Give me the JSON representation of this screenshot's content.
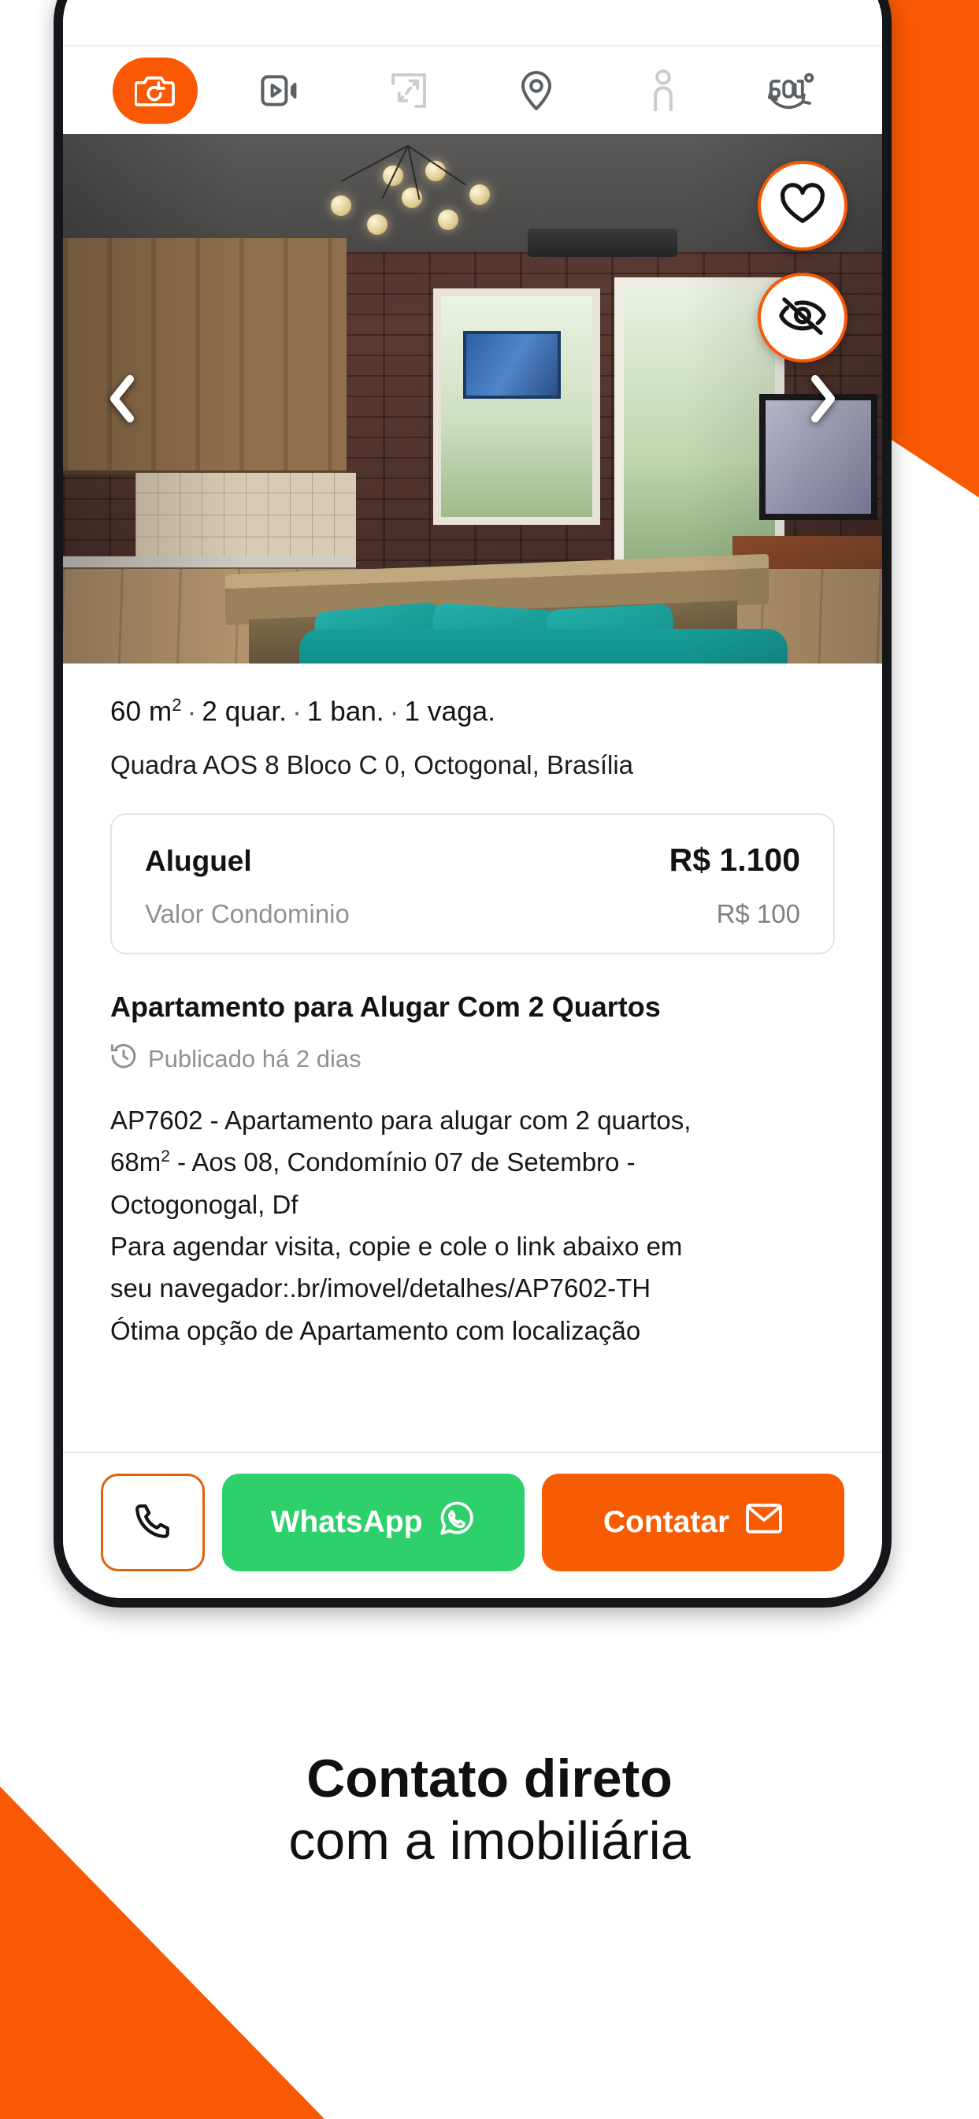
{
  "theme": {
    "accent_orange": "#f95804",
    "whatsapp_green": "#2ed06b",
    "contact_orange": "#f75c02",
    "text_dark": "#111315",
    "text_muted": "#8d9295"
  },
  "media_tabs": [
    {
      "name": "photos",
      "icon": "camera-icon",
      "active": true
    },
    {
      "name": "video",
      "icon": "video-icon",
      "active": false
    },
    {
      "name": "floorplan",
      "icon": "floorplan-icon",
      "active": false
    },
    {
      "name": "map",
      "icon": "map-pin-icon",
      "active": false
    },
    {
      "name": "virtual-tour",
      "icon": "person-icon",
      "active": false
    },
    {
      "name": "panorama",
      "icon": "360-icon",
      "active": false
    }
  ],
  "gallery": {
    "prev_label": "‹",
    "next_label": "›",
    "favorite_icon": "heart-icon",
    "hide_icon": "eye-off-icon"
  },
  "listing": {
    "area": "60 m",
    "area_sup": "2",
    "bedrooms": "2 quar.",
    "bathrooms": "1 ban.",
    "parking": "1 vaga.",
    "separator": "·",
    "address": "Quadra AOS 8 Bloco C 0, Octogonal, Brasília",
    "price": {
      "rent_label": "Aluguel",
      "rent_value": "R$ 1.100",
      "condo_label": "Valor Condominio",
      "condo_value": "R$ 100"
    },
    "title": "Apartamento para Alugar Com 2 Quartos",
    "published": "Publicado há 2 dias",
    "published_icon": "clock-history-icon",
    "description_lines": [
      "AP7602 - Apartamento para alugar com 2 quartos,",
      "68m|2| - Aos 08, Condomínio 07 de Setembro -",
      "Octogonogal, Df",
      "Para agendar visita, copie e cole o link abaixo em",
      "seu navegador:.br/imovel/detalhes/AP7602-TH",
      "Ótima opção de Apartamento com localização"
    ]
  },
  "actions": {
    "call_icon": "phone-icon",
    "whatsapp_label": "WhatsApp",
    "whatsapp_icon": "whatsapp-icon",
    "contact_label": "Contatar",
    "contact_icon": "envelope-icon"
  },
  "headline": {
    "line1": "Contato direto",
    "line2": "com a imobiliária"
  }
}
